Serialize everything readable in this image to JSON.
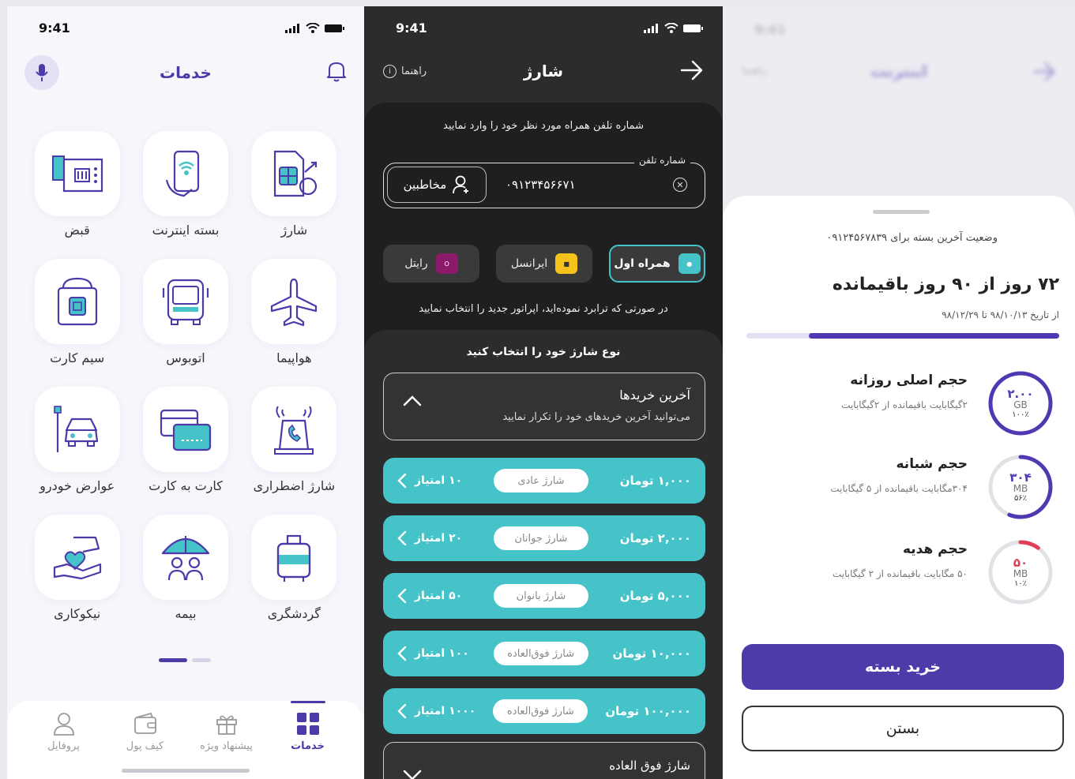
{
  "status_time": "9:41",
  "services": {
    "title": "خدمات",
    "tiles": [
      {
        "label": "شارژ",
        "icon": "sim-charge-icon"
      },
      {
        "label": "بسته اینترنت",
        "icon": "mobile-internet-icon"
      },
      {
        "label": "قبض",
        "icon": "bill-icon"
      },
      {
        "label": "هواپیما",
        "icon": "airplane-icon"
      },
      {
        "label": "اتوبوس",
        "icon": "bus-icon"
      },
      {
        "label": "سیم کارت",
        "icon": "sim-card-icon"
      },
      {
        "label": "شارژ اضطراری",
        "icon": "emergency-call-icon"
      },
      {
        "label": "کارت به کارت",
        "icon": "card-transfer-icon"
      },
      {
        "label": "عوارض خودرو",
        "icon": "car-toll-icon"
      },
      {
        "label": "گردشگری",
        "icon": "luggage-icon"
      },
      {
        "label": "بیمه",
        "icon": "insurance-umbrella-icon"
      },
      {
        "label": "نیکوکاری",
        "icon": "charity-hand-heart-icon"
      }
    ],
    "tabs": [
      {
        "label": "خدمات",
        "icon": "grid-icon",
        "active": true
      },
      {
        "label": "پیشنهاد ویژه",
        "icon": "gift-icon",
        "active": false
      },
      {
        "label": "کیف پول",
        "icon": "wallet-icon",
        "active": false
      },
      {
        "label": "پروفایل",
        "icon": "user-icon",
        "active": false
      }
    ]
  },
  "charge": {
    "title": "شارژ",
    "guide": "راهنما",
    "instruction": "شماره تلفن همراه مورد نظر خود را وارد نمایید",
    "phone_label": "شماره تلفن",
    "phone_value": "۰۹۱۲۳۴۵۶۶۷۱",
    "contacts": "مخاطبین",
    "operators": [
      {
        "label": "همراه اول",
        "selected": true,
        "color": "#46c2c9"
      },
      {
        "label": "ایرانسل",
        "selected": false,
        "color": "#f4c21b"
      },
      {
        "label": "رایتل",
        "selected": false,
        "color": "#8c1a6a"
      }
    ],
    "operator_note": "در صورتی که ترابرد نموده‌اید، اپراتور جدید را انتخاب نمایید",
    "type_heading": "نوع شارژ خود را انتخاب کنید",
    "recent_title": "آخرین خریدها",
    "recent_sub": "می‌توانید آخرین خریدهای خود را تکرار نمایید",
    "plans": [
      {
        "price": "۱,۰۰۰ تومان",
        "type": "شارژ عادی",
        "points": "۱۰ امتیاز"
      },
      {
        "price": "۲,۰۰۰ تومان",
        "type": "شارژ جوانان",
        "points": "۲۰ امتیاز"
      },
      {
        "price": "۵,۰۰۰ تومان",
        "type": "شارژ بانوان",
        "points": "۵۰ امتیاز"
      },
      {
        "price": "۱۰,۰۰۰ تومان",
        "type": "شارژ فوق‌العاده",
        "points": "۱۰۰ امتیاز"
      },
      {
        "price": "۱۰۰,۰۰۰ تومان",
        "type": "شارژ فوق‌العاده",
        "points": "۱۰۰۰ امتیاز"
      }
    ],
    "extra_title": "شارژ فوق العاده"
  },
  "internet": {
    "title": "اینترنت",
    "guide": "راهنما",
    "status_for": "وضعیت آخرین بسته برای ۰۹۱۲۴۵۶۷۸۳۹",
    "days_left": "۷۲ روز از ۹۰ روز باقیمانده",
    "date_range": "از تاریخ ۹۸/۱۰/۱۳ تا ۹۸/۱۲/۲۹",
    "days_progress": 0.8,
    "volumes": [
      {
        "title": "حجم اصلی روزانه",
        "sub": "۲گیگابایت باقیمانده از ۲گیگابایت",
        "amount": "۲.۰۰",
        "unit": "GB",
        "percent": "۱۰۰٪",
        "fraction": 1.0,
        "color": "#5038b3"
      },
      {
        "title": "حجم شبانه",
        "sub": "۳۰۴مگابایت باقیمانده از ۵ گیگابایت",
        "amount": "۳۰۴",
        "unit": "MB",
        "percent": "۵۶٪",
        "fraction": 0.56,
        "color": "#5038b3"
      },
      {
        "title": "حجم هدیه",
        "sub": "۵۰ مگابایت باقیمانده از ۲ گیگابایت",
        "amount": "۵۰",
        "unit": "MB",
        "percent": "۱۰٪",
        "fraction": 0.1,
        "color": "#e04057"
      }
    ],
    "buy_label": "خرید بسته",
    "close_label": "بستن"
  }
}
